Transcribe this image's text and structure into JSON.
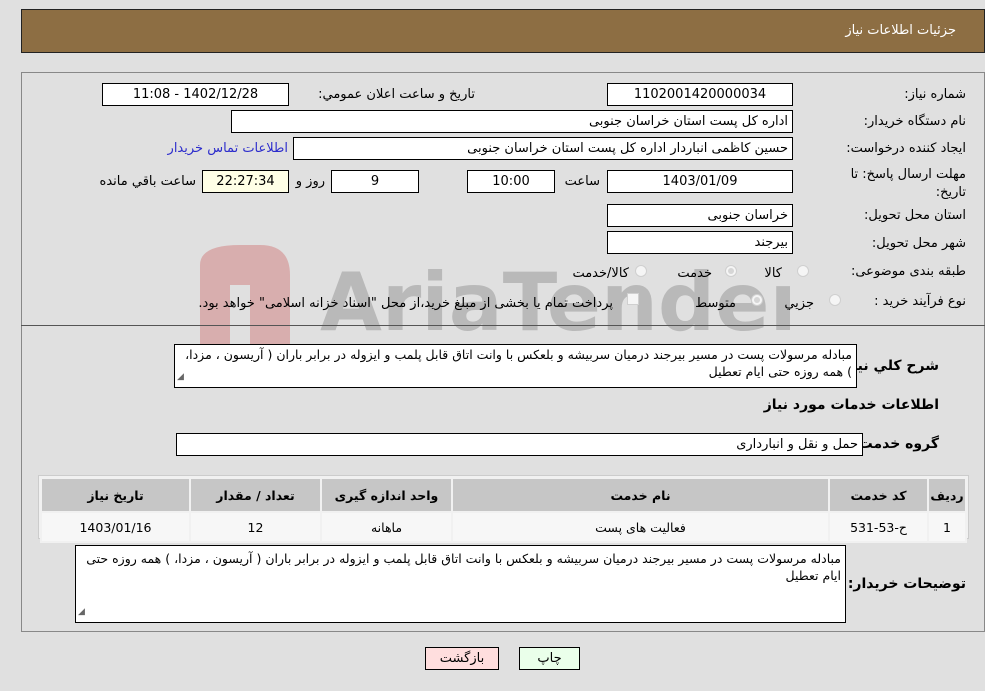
{
  "header": {
    "title": "جزئيات اطلاعات نياز"
  },
  "form": {
    "need_number": {
      "label": "شماره نياز:",
      "value": "1102001420000034"
    },
    "announce_datetime": {
      "label": "تاريخ و ساعت اعلان عمومي:",
      "value": "1402/12/28 - 11:08"
    },
    "buyer_org": {
      "label": "نام دستگاه خريدار:",
      "value": "اداره کل پست استان خراسان جنوبی"
    },
    "requester": {
      "label": "ايجاد کننده درخواست:",
      "value": "حسین کاظمی انباردار اداره کل پست استان خراسان جنوبی"
    },
    "buyer_contact_link": "اطلاعات تماس خريدار",
    "deadline": {
      "label": "مهلت ارسال پاسخ: تا تاريخ:",
      "date": "1403/01/09",
      "time_label": "ساعت",
      "time": "10:00",
      "days": "9",
      "days_label": "روز و",
      "remaining": "22:27:34",
      "remaining_label": "ساعت باقي مانده"
    },
    "delivery_province": {
      "label": "استان محل تحويل:",
      "value": "خراسان جنوبی"
    },
    "delivery_city": {
      "label": "شهر محل تحويل:",
      "value": "بیرجند"
    },
    "category": {
      "label": "طبقه بندی موضوعی:",
      "options": [
        "کالا",
        "خدمت",
        "کالا/خدمت"
      ],
      "selected": "خدمت"
    },
    "process_type": {
      "label": "نوع فرآيند خريد :",
      "options": [
        "جزيي",
        "متوسط"
      ],
      "selected": "متوسط",
      "treasury_note": "پرداخت تمام يا بخشی از مبلغ خريد،از محل \"اسناد خزانه اسلامی\" خواهد بود.",
      "treasury_checked": false
    },
    "general_description": {
      "label": "شرح كلي نياز:",
      "value": "مبادله  مرسولات پست در مسیر بیرجند درمیان سربیشه و بلعکس با وانت اتاق  قابل پلمب و ایزوله در برابر باران  ( آریسون ، مزدا، ) همه روزه حتی ایام تعطیل"
    },
    "services_section_title": "اطلاعات خدمات مورد نياز",
    "service_group": {
      "label": "گروه خدمت:",
      "value": "حمل و نقل و انبارداری"
    }
  },
  "services_table": {
    "columns": [
      "رديف",
      "كد خدمت",
      "نام خدمت",
      "واحد اندازه گيری",
      "تعداد / مقدار",
      "تاريخ نياز"
    ],
    "rows": [
      {
        "row": "1",
        "code": "ح-53-531",
        "name": "فعالیت های پست",
        "unit": "ماهانه",
        "qty": "12",
        "date": "1403/01/16"
      }
    ]
  },
  "buyer_notes": {
    "label": "توضيحات خريدار:",
    "value": "مبادله  مرسولات پست در مسیر بیرجند درمیان سربیشه و بلعکس با وانت اتاق  قابل پلمب و ایزوله در برابر باران  ( آریسون ، مزدا، ) همه روزه حتی ایام تعطیل"
  },
  "buttons": {
    "print": "چاپ",
    "back": "بازگشت"
  },
  "colors": {
    "header_bg": "#8d6e43",
    "print_bg": "#eaffea",
    "back_bg": "#ffdede",
    "link": "#2d2dcc"
  },
  "watermark": {
    "text": "AriaTender.neT"
  }
}
